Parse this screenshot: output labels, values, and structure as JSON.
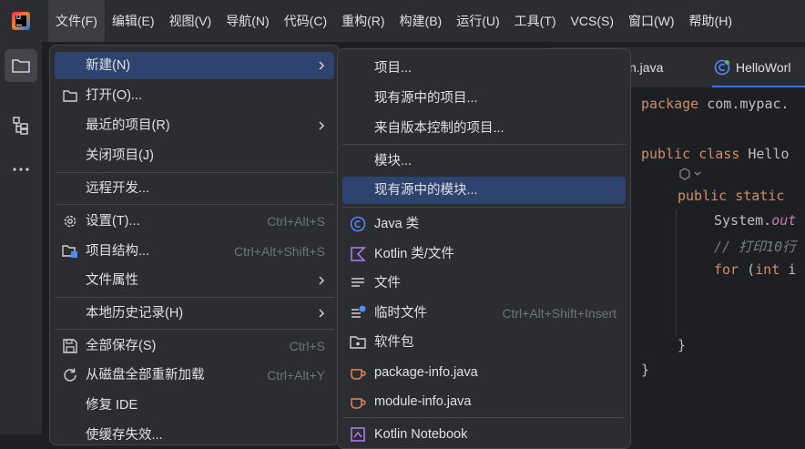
{
  "menubar": {
    "items": [
      "文件(F)",
      "编辑(E)",
      "视图(V)",
      "导航(N)",
      "代码(C)",
      "重构(R)",
      "构建(B)",
      "运行(U)",
      "工具(T)",
      "VCS(S)",
      "窗口(W)",
      "帮助(H)"
    ],
    "active": "文件(F)"
  },
  "tabs": [
    {
      "label": "n.java",
      "active": false
    },
    {
      "label": "HelloWorl",
      "active": true
    }
  ],
  "code": {
    "line1": [
      "package",
      " com.mypac."
    ],
    "line2": [
      "public class",
      " Hello"
    ],
    "line3": [
      "public static",
      ""
    ],
    "line4": [
      "System.",
      "out"
    ],
    "line5": "// 打印10行",
    "line6": [
      "for",
      " (",
      "int",
      " i"
    ],
    "line7": "}",
    "line8": "}"
  },
  "file_menu": {
    "items": [
      {
        "label": "新建(N)",
        "submenu": true,
        "icon": "none"
      },
      {
        "label": "打开(O)...",
        "icon": "folder-icon"
      },
      {
        "label": "最近的项目(R)",
        "submenu": true,
        "icon": "none"
      },
      {
        "label": "关闭项目(J)",
        "icon": "none"
      },
      {
        "label": "远程开发...",
        "icon": "none"
      },
      {
        "label": "设置(T)...",
        "shortcut": "Ctrl+Alt+S",
        "icon": "gear-icon"
      },
      {
        "label": "项目结构...",
        "shortcut": "Ctrl+Alt+Shift+S",
        "icon": "project-structure-icon"
      },
      {
        "label": "文件属性",
        "submenu": true,
        "icon": "none"
      },
      {
        "label": "本地历史记录(H)",
        "submenu": true,
        "icon": "none"
      },
      {
        "label": "全部保存(S)",
        "shortcut": "Ctrl+S",
        "icon": "save-icon"
      },
      {
        "label": "从磁盘全部重新加载",
        "shortcut": "Ctrl+Alt+Y",
        "icon": "reload-icon"
      },
      {
        "label": "修复 IDE",
        "icon": "none"
      },
      {
        "label": "使缓存失效...",
        "icon": "none"
      }
    ]
  },
  "new_submenu": {
    "items": [
      {
        "label": "项目...",
        "icon": "none"
      },
      {
        "label": "现有源中的项目...",
        "icon": "none"
      },
      {
        "label": "来自版本控制的项目...",
        "icon": "none"
      },
      {
        "label": "模块...",
        "icon": "none"
      },
      {
        "label": "现有源中的模块...",
        "icon": "none"
      },
      {
        "label": "Java 类",
        "icon": "java-class-icon"
      },
      {
        "label": "Kotlin 类/文件",
        "icon": "kotlin-icon"
      },
      {
        "label": "文件",
        "icon": "file-icon"
      },
      {
        "label": "临时文件",
        "shortcut": "Ctrl+Alt+Shift+Insert",
        "icon": "scratch-file-icon"
      },
      {
        "label": "软件包",
        "icon": "package-icon"
      },
      {
        "label": "package-info.java",
        "icon": "java-file-icon"
      },
      {
        "label": "module-info.java",
        "icon": "java-file-icon"
      },
      {
        "label": "Kotlin Notebook",
        "icon": "kotlin-notebook-icon"
      }
    ]
  },
  "colors": {
    "accent": "#3574f0",
    "selection": "#2e436e",
    "menu_bg": "#2b2d30",
    "keyword": "#cf8e6d"
  }
}
